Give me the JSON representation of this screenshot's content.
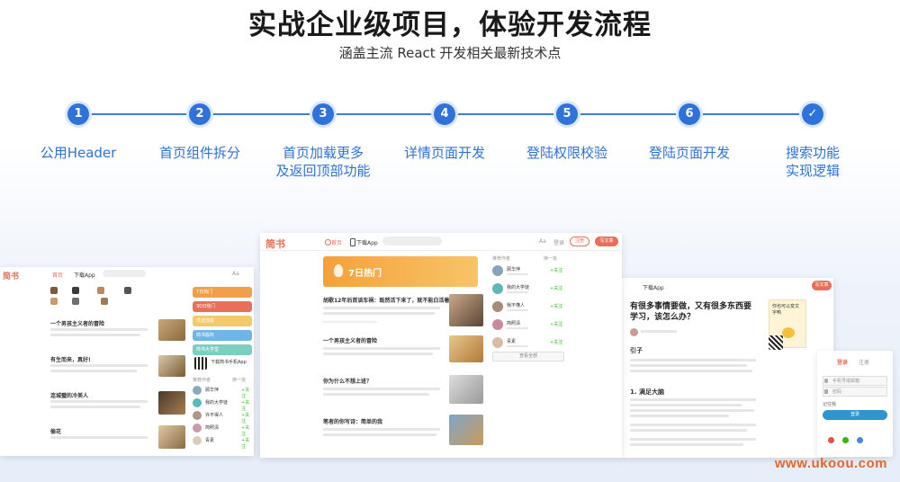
{
  "heading": {
    "title": "实战企业级项目，体验开发流程",
    "subtitle": "涵盖主流 React 开发相关最新技术点"
  },
  "steps": [
    {
      "num": "1",
      "label": "公用Header"
    },
    {
      "num": "2",
      "label": "首页组件拆分"
    },
    {
      "num": "3",
      "label": "首页加载更多\n及返回顶部功能"
    },
    {
      "num": "4",
      "label": "详情页面开发"
    },
    {
      "num": "5",
      "label": "登陆权限校验"
    },
    {
      "num": "6",
      "label": "登陆页面开发"
    },
    {
      "num": "✓",
      "label": "搜索功能\n实现逻辑"
    }
  ],
  "screens": {
    "logo": "简书",
    "nav_home": "首页",
    "nav_app": "下载App",
    "nav_aa": "Aa",
    "nav_login": "登录",
    "nav_signup": "注册",
    "nav_write": "写文章",
    "hot_banner": "7日热门",
    "articles": [
      "胡歌12年后首谈车祸：既然活下来了，就不能白活着",
      "一个男孩主义者的冒险",
      "你为什么不想上班？",
      "笔者的你写诗：简单的我"
    ],
    "left_articles": [
      "一个男孩主义者的冒险",
      "有生而来，真好!",
      "连城璧的冷美人",
      "偷花"
    ],
    "recommend_title": "推荐作者",
    "recommend_change": "换一批",
    "authors": [
      "顾华萍",
      "我的大学徒",
      "我不懂人",
      "简照清",
      "青素"
    ],
    "follow": "+关注",
    "more_authors": "查看全部",
    "left_recommend_title": "推荐作者",
    "left_recommend_change": "换一批",
    "left_authors": [
      "顾华萍",
      "我的大学徒",
      "许不得人",
      "简照清",
      "青素"
    ],
    "left_banners": [
      "7日热门",
      "30日热门",
      "优选连载",
      "简书版权",
      "简书大学堂"
    ],
    "download_app": "下载简书手机App",
    "detail_title": "有很多事情要做，又有很多东西要学习，该怎么办？",
    "detail_section_intro": "引子",
    "detail_section_1": "1. 满足大脑",
    "login_tab": "登录",
    "signup_tab": "注册",
    "login_placeholder_user": "手机号或邮箱",
    "login_placeholder_pass": "密码",
    "login_remember": "记住我",
    "login_button": "登录",
    "ad_text": "你也可以变文字鸭"
  },
  "watermark": "www.ukoou.com"
}
